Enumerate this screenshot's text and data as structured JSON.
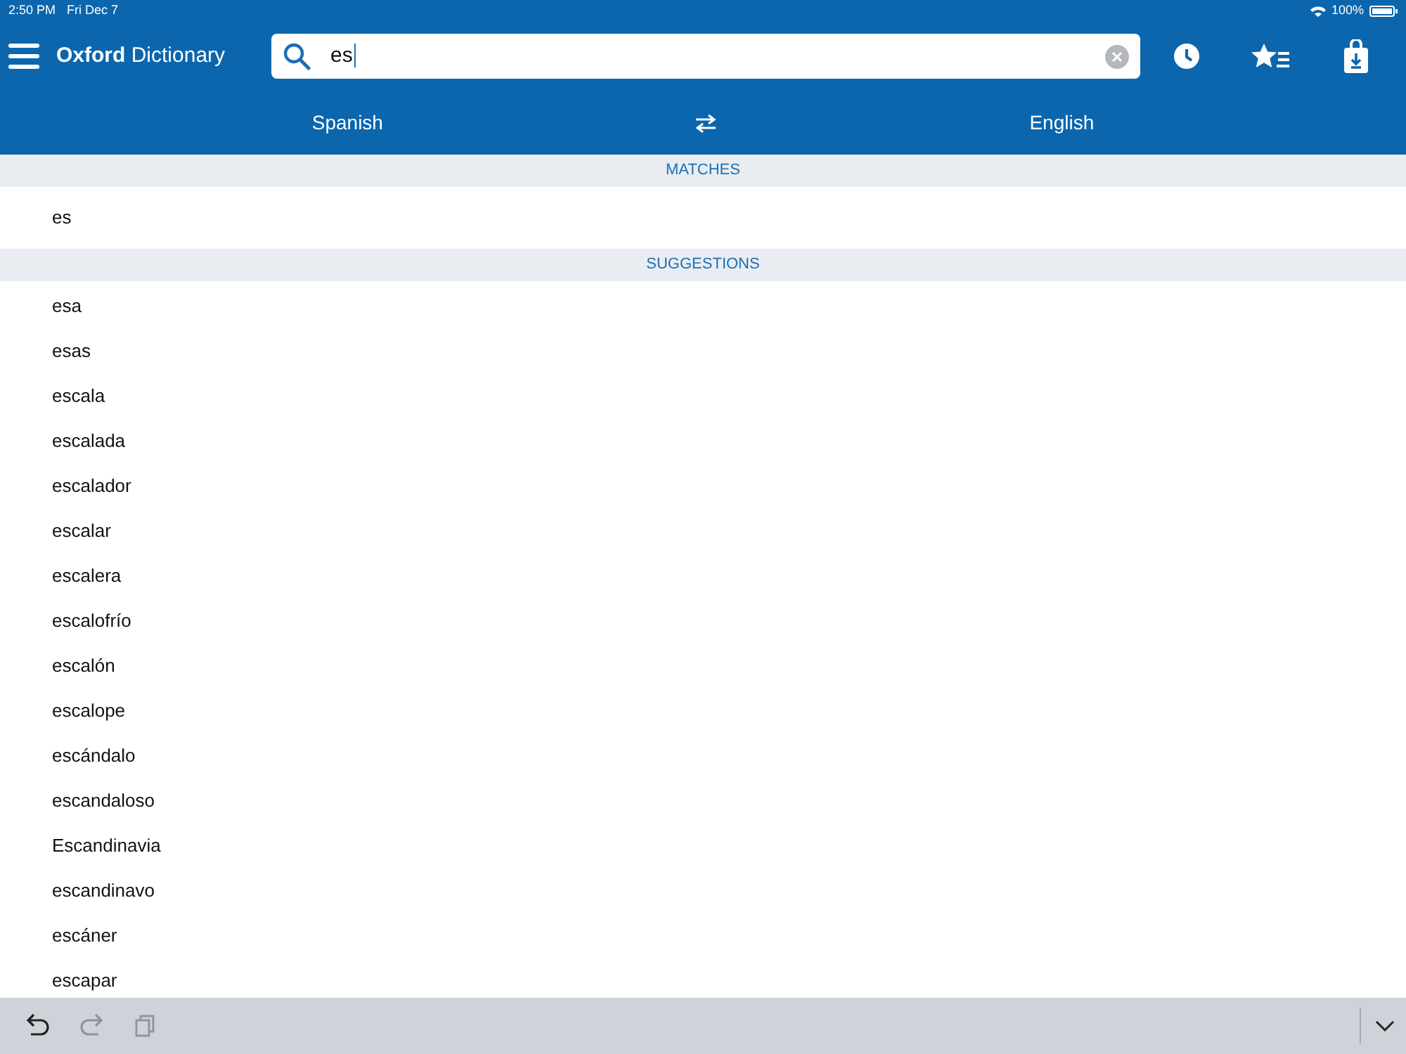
{
  "status_bar": {
    "time": "2:50 PM",
    "date": "Fri Dec 7",
    "battery": "100%"
  },
  "header": {
    "title_bold": "Oxford",
    "title": "Dictionary",
    "search": {
      "value": "es"
    }
  },
  "languages": {
    "source": "Spanish",
    "target": "English"
  },
  "sections": [
    {
      "title": "MATCHES",
      "items": [
        "es"
      ]
    },
    {
      "title": "SUGGESTIONS",
      "items": [
        "esa",
        "esas",
        "escala",
        "escalada",
        "escalador",
        "escalar",
        "escalera",
        "escalofrío",
        "escalón",
        "escalope",
        "escándalo",
        "escandaloso",
        "Escandinavia",
        "escandinavo",
        "escáner",
        "escapar"
      ]
    }
  ],
  "keyboard_bar": {
    "tools": [
      {
        "kind": "undo",
        "disabled": false
      },
      {
        "kind": "redo",
        "disabled": true
      },
      {
        "kind": "paste",
        "disabled": true
      }
    ]
  }
}
